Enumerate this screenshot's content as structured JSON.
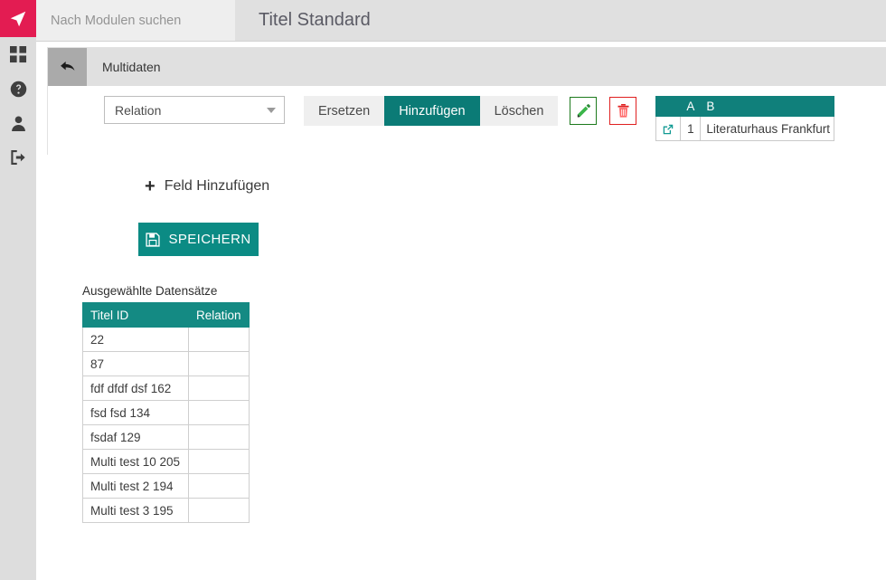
{
  "sidebar": {
    "logo": {
      "icon": "navigation-arrow-icon",
      "bg": "#e31c52"
    },
    "items": [
      {
        "icon": "grid-dashboard-icon",
        "label": "Dashboard"
      },
      {
        "icon": "help-circle-icon",
        "label": "Hilfe"
      },
      {
        "icon": "user-icon",
        "label": "Benutzer"
      },
      {
        "icon": "logout-icon",
        "label": "Abmelden"
      }
    ]
  },
  "topbar": {
    "search_placeholder": "Nach Modulen suchen",
    "search_value": "",
    "page_title": "Titel Standard"
  },
  "panel": {
    "back_icon": "back-arrow-icon",
    "title": "Multidaten",
    "select": {
      "value": "Relation",
      "caret_icon": "chevron-down-icon"
    },
    "mode_buttons": [
      {
        "label": "Ersetzen",
        "active": false
      },
      {
        "label": "Hinzufügen",
        "active": true
      },
      {
        "label": "Löschen",
        "active": false
      }
    ],
    "edit_button": {
      "icon": "pencil-icon",
      "color": "#1d7a1d"
    },
    "delete_button": {
      "icon": "trash-icon",
      "color": "#e02020"
    },
    "mini_sheet": {
      "headers": [
        "",
        "A",
        "B"
      ],
      "rows": [
        {
          "open_icon": "external-link-icon",
          "num": "1",
          "value": "Literaturhaus Frankfurt"
        }
      ]
    }
  },
  "add_field": {
    "plus": "+",
    "label": "Feld Hinzufügen"
  },
  "save": {
    "icon": "floppy-save-icon",
    "label": "SPEICHERN"
  },
  "records": {
    "caption": "Ausgewählte Datensätze",
    "headers": [
      "Titel ID",
      "Relation"
    ],
    "rows": [
      {
        "titel_id": "22",
        "relation": ""
      },
      {
        "titel_id": "87",
        "relation": ""
      },
      {
        "titel_id": "fdf dfdf dsf 162",
        "relation": ""
      },
      {
        "titel_id": "fsd fsd 134",
        "relation": ""
      },
      {
        "titel_id": "fsdaf 129",
        "relation": ""
      },
      {
        "titel_id": "Multi test 10 205",
        "relation": ""
      },
      {
        "titel_id": "Multi test 2 194",
        "relation": ""
      },
      {
        "titel_id": "Multi test 3 195",
        "relation": ""
      }
    ]
  },
  "colors": {
    "accent_teal": "#0b7b76",
    "logo_crimson": "#e31c52",
    "header_gray": "#e0e0e0",
    "sidebar_gray": "#dddddd"
  }
}
